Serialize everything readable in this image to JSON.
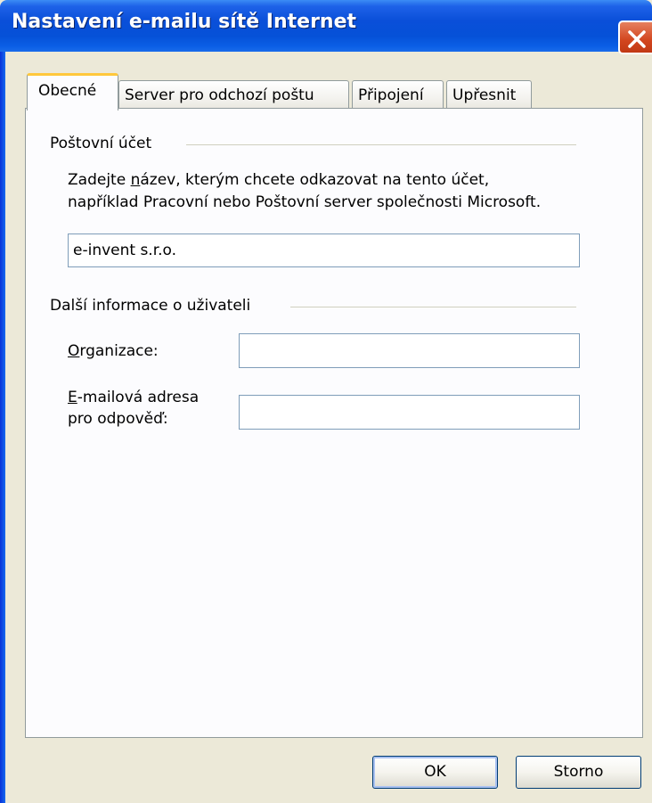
{
  "window": {
    "title": "Nastavení e-mailu sítě Internet"
  },
  "tabs": [
    {
      "label": "Obecné",
      "active": true
    },
    {
      "label": "Server pro odchozí poštu",
      "active": false
    },
    {
      "label": "Připojení",
      "active": false
    },
    {
      "label": "Upřesnit",
      "active": false
    }
  ],
  "account_group": {
    "title": "Poštovní účet",
    "desc_line1_pre": "Zadejte ",
    "desc_line1_accel": "n",
    "desc_line1_post": "ázev, kterým chcete odkazovat na tento účet,",
    "desc_line2": "například Pracovní nebo Poštovní server společnosti Microsoft.",
    "account_name_value": "e-invent s.r.o."
  },
  "user_info_group": {
    "title": "Další informace o uživateli",
    "organization_accel": "O",
    "organization_rest": "rganizace:",
    "organization_value": "",
    "reply_accel": "E",
    "reply_rest_line1": "-mailová adresa",
    "reply_line2": "pro odpověď:",
    "reply_value": ""
  },
  "buttons": {
    "ok": "OK",
    "cancel": "Storno"
  },
  "colors": {
    "titlebar": "#0A4FD9",
    "close_button": "#D2451E",
    "dialog_bg": "#ECE9D8",
    "panel_bg": "#FCFCFE",
    "active_tab_highlight": "#FFC83C"
  },
  "icons": {
    "close": "close-icon"
  }
}
